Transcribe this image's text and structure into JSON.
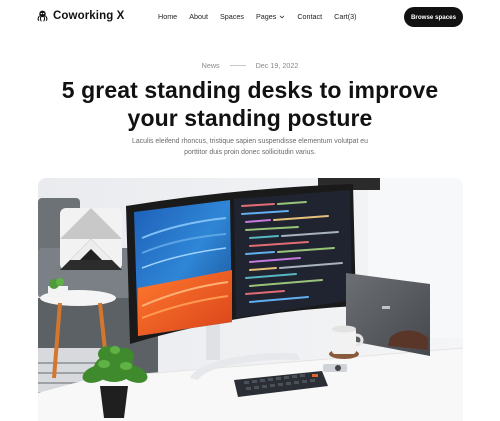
{
  "brand": {
    "name": "Coworking X",
    "icon": "octopus-icon"
  },
  "nav": {
    "items": [
      {
        "label": "Home"
      },
      {
        "label": "About"
      },
      {
        "label": "Spaces"
      },
      {
        "label": "Pages",
        "icon": "chevron-down-icon"
      },
      {
        "label": "Contact"
      },
      {
        "label": "Cart(3)"
      }
    ]
  },
  "cta": {
    "label": "Browse spaces"
  },
  "article": {
    "category": "News",
    "date": "Dec 19, 2022",
    "title": "5 great standing desks to improve your standing posture",
    "lead": "Laculis eleifend rhoncus, tristique sapien suspendisse elementum volutpat eu porttitor duis proin donec sollicitudin varius."
  },
  "colors": {
    "accent": "#111111",
    "text_muted": "#6b6b6b",
    "background": "#ffffff"
  }
}
